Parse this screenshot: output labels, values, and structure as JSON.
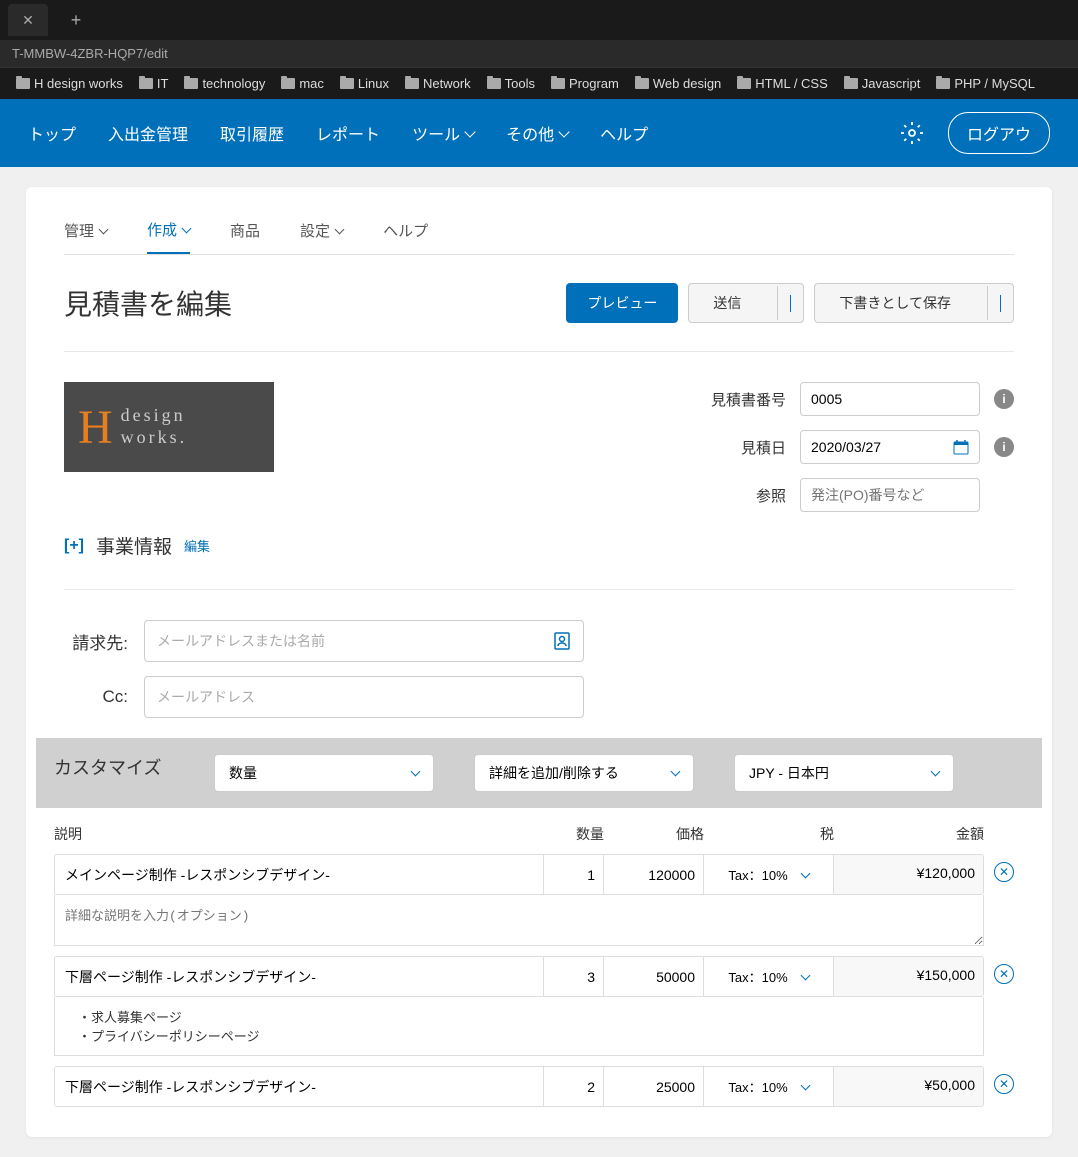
{
  "browser": {
    "url_fragment": "T-MMBW-4ZBR-HQP7/edit",
    "bookmarks": [
      "H design works",
      "IT",
      "technology",
      "mac",
      "Linux",
      "Network",
      "Tools",
      "Program",
      "Web design",
      "HTML / CSS",
      "Javascript",
      "PHP / MySQL"
    ]
  },
  "main_nav": {
    "items": [
      "トップ",
      "入出金管理",
      "取引履歴",
      "レポート",
      "ツール",
      "その他",
      "ヘルプ"
    ],
    "logout": "ログアウ"
  },
  "sub_tabs": {
    "items": [
      "管理",
      "作成",
      "商品",
      "設定",
      "ヘルプ"
    ],
    "active_index": 1
  },
  "page": {
    "title": "見積書を編集",
    "preview_btn": "プレビュー",
    "send_btn": "送信",
    "draft_btn": "下書きとして保存"
  },
  "logo": {
    "h": "H",
    "line1": "design",
    "line2": "works."
  },
  "meta": {
    "number_label": "見積書番号",
    "number_value": "0005",
    "date_label": "見積日",
    "date_value": "2020/03/27",
    "ref_label": "参照",
    "ref_placeholder": "発注(PO)番号など"
  },
  "biz": {
    "expand": "[+]",
    "label": "事業情報",
    "edit": "編集"
  },
  "recipient": {
    "to_label": "請求先:",
    "to_placeholder": "メールアドレスまたは名前",
    "cc_label": "Cc:",
    "cc_placeholder": "メールアドレス"
  },
  "customize": {
    "label": "カスタマイズ",
    "qty_select": "数量",
    "detail_select": "詳細を追加/削除する",
    "currency_select": "JPY - 日本円"
  },
  "columns": {
    "desc": "説明",
    "qty": "数量",
    "price": "価格",
    "tax": "税",
    "amount": "金額"
  },
  "items": [
    {
      "desc": "メインページ制作 -レスポンシブデザイン-",
      "qty": "1",
      "price": "120000",
      "tax": "Tax：10%",
      "amount": "¥120,000",
      "detail_placeholder": "詳細な説明を入力(オプション)",
      "detail": ""
    },
    {
      "desc": "下層ページ制作 -レスポンシブデザイン-",
      "qty": "3",
      "price": "50000",
      "tax": "Tax：10%",
      "amount": "¥150,000",
      "detail": "　・求人募集ページ\n　・プライバシーポリシーページ"
    },
    {
      "desc": "下層ページ制作 -レスポンシブデザイン-",
      "qty": "2",
      "price": "25000",
      "tax": "Tax：10%",
      "amount": "¥50,000",
      "detail": ""
    }
  ]
}
